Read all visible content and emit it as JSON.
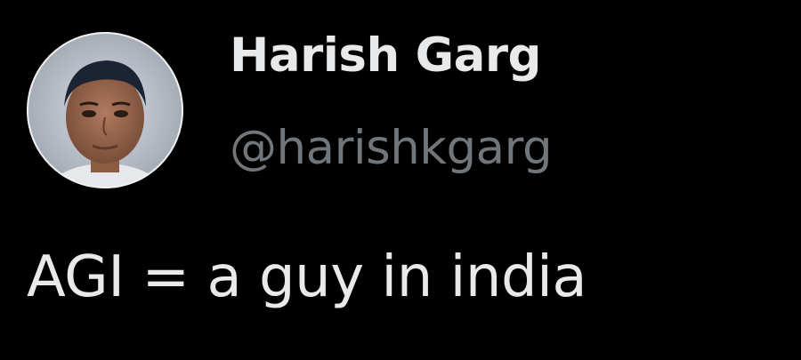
{
  "author": {
    "display_name": "Harish Garg",
    "handle": "@harishkgarg",
    "avatar_icon": "profile-photo"
  },
  "tweet": {
    "text": "AGI = a guy in india"
  },
  "colors": {
    "background": "#000000",
    "primary_text": "#e7e9ea",
    "secondary_text": "#71767b"
  }
}
